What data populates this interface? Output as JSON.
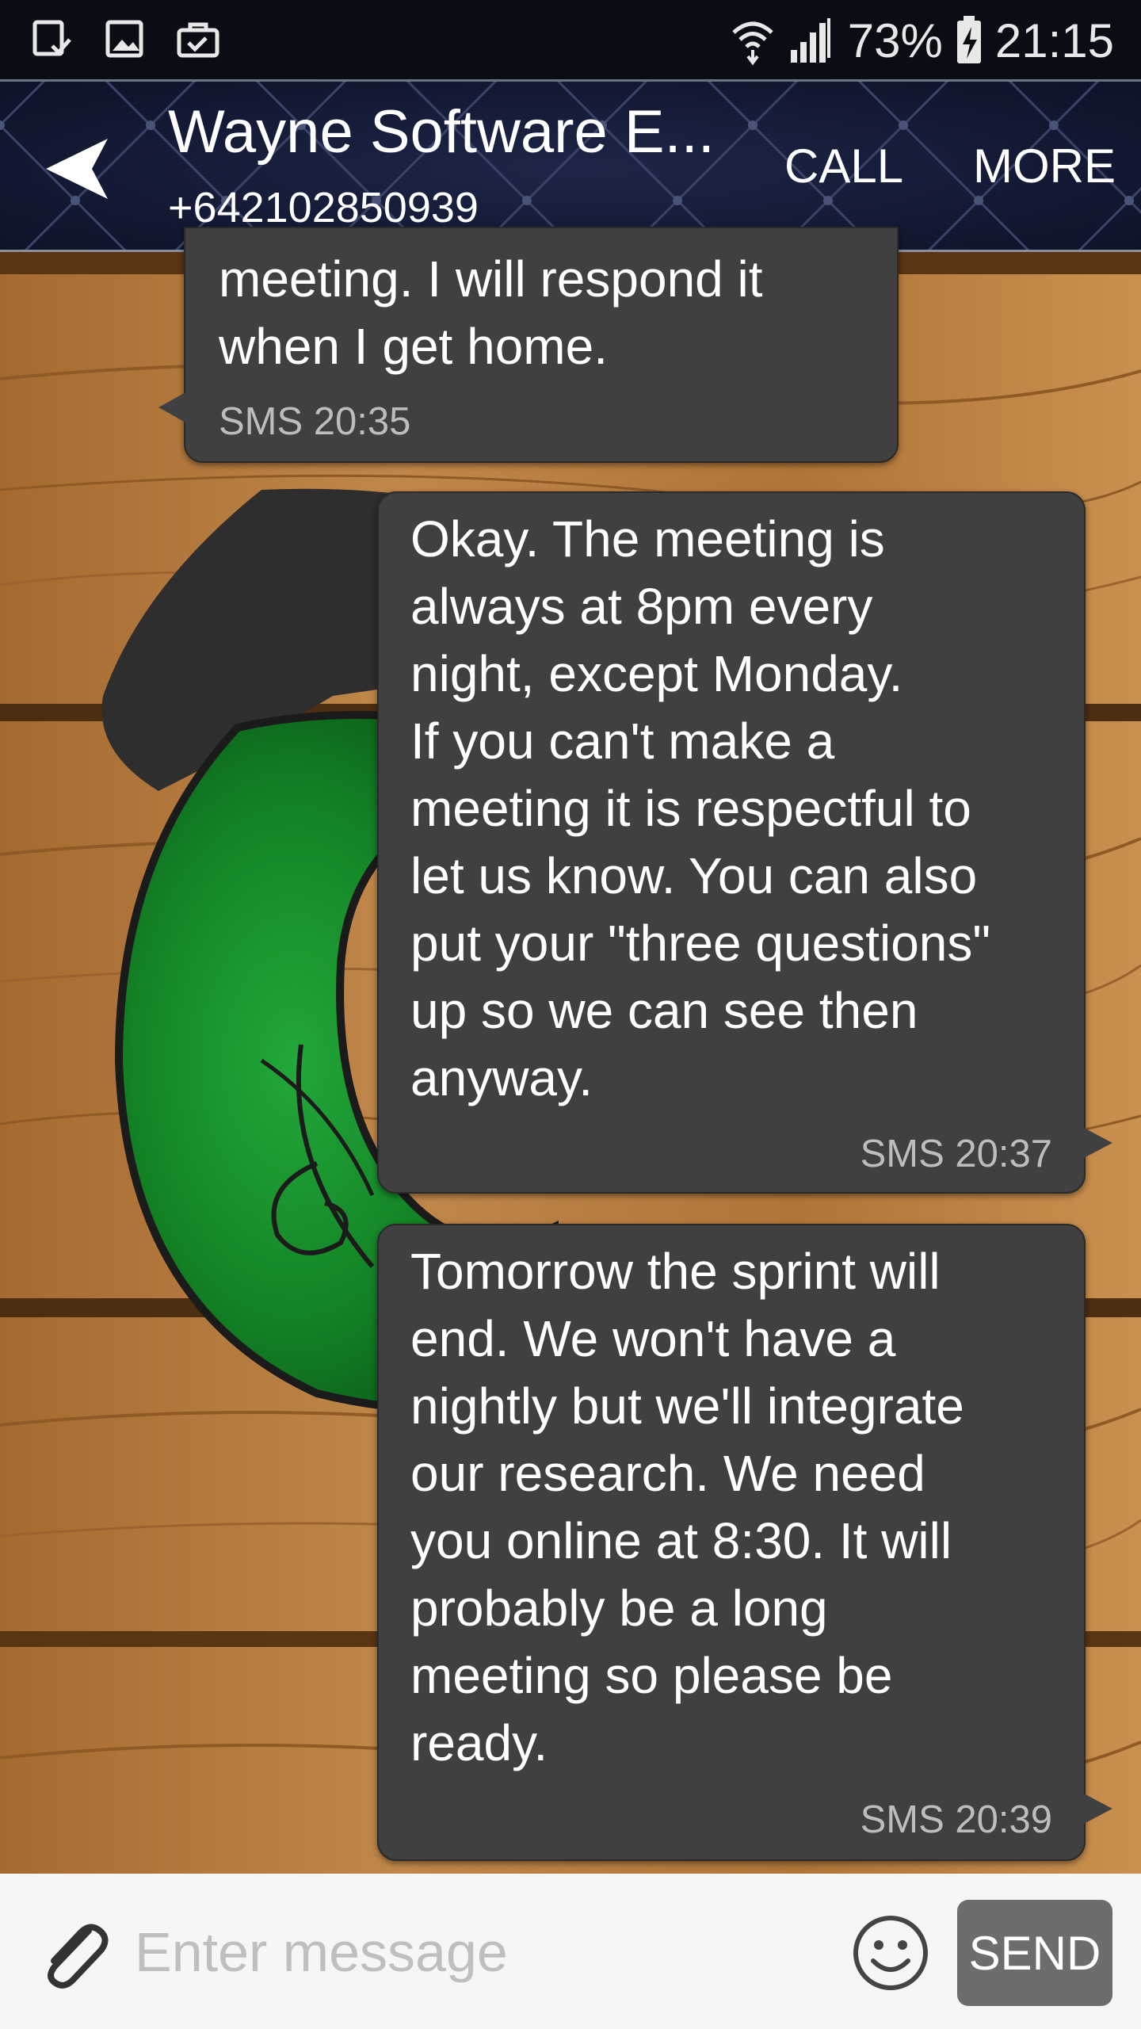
{
  "status_bar": {
    "notification_icons": [
      "download-complete-icon",
      "gallery-icon",
      "briefcase-check-icon"
    ],
    "signal_icons": [
      "wifi-icon",
      "cell-signal-icon"
    ],
    "battery_percent": "73%",
    "battery_icon": "battery-charging-icon",
    "time": "21:15"
  },
  "header": {
    "contact_name": "Wayne Software E...",
    "phone_number": "+642102850939",
    "call_label": "CALL",
    "more_label": "MORE"
  },
  "messages": [
    {
      "direction": "incoming",
      "text": "meeting. I will respond it\nwhen I get home.",
      "meta": "SMS 20:35"
    },
    {
      "direction": "outgoing",
      "text": "Okay. The meeting is\nalways at 8pm every\nnight, except Monday.\nIf you can't make a\nmeeting it is respectful to\nlet us know. You can also\nput your \"three questions\"\nup so we can see then\nanyway.",
      "meta": "SMS 20:37"
    },
    {
      "direction": "outgoing",
      "text": "Tomorrow the sprint will\nend. We won't have a\nnightly but we'll integrate\nour research. We need\nyou online at 8:30. It will\nprobably be a long\nmeeting so please be\nready.",
      "meta": "SMS 20:39"
    }
  ],
  "composer": {
    "placeholder": "Enter message",
    "value": "",
    "send_label": "SEND",
    "attach_icon": "paperclip-icon",
    "emoji_icon": "smiley-icon"
  },
  "colors": {
    "status_bar_bg": "#0b0d14",
    "header_bg": "#141b36",
    "bubble_bg": "#404040",
    "send_button_bg": "#6d6d6d",
    "wood": "#b77a3c",
    "glass_green": "#178a2a"
  }
}
